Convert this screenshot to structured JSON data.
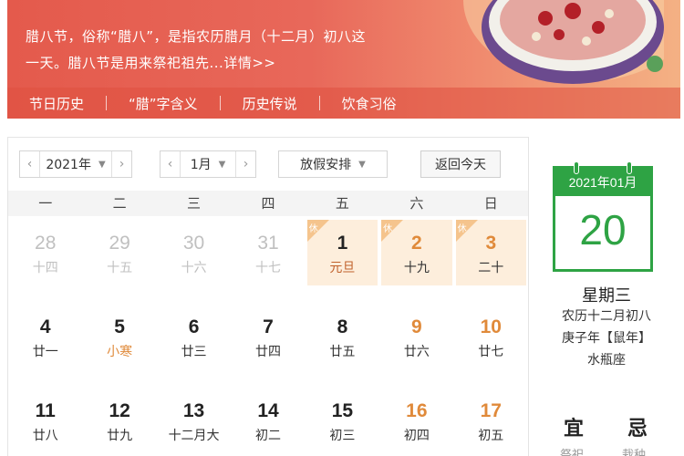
{
  "banner": {
    "text_line1": "腊八节，俗称“腊八”，是指农历腊月（十二月）初八这",
    "text_line2": "一天。腊八节是用来祭祀祖先...",
    "more_label": "详情>>",
    "nav": [
      "节日历史",
      "“腊”字含义",
      "历史传说",
      "饮食习俗"
    ]
  },
  "toolbar": {
    "year": "2021年",
    "month": "1月",
    "holiday": "放假安排",
    "today": "返回今天",
    "prev_icon": "chevron-left-icon",
    "next_icon": "chevron-right-icon",
    "caret_icon": "caret-down-icon"
  },
  "weekdays": [
    "一",
    "二",
    "三",
    "四",
    "五",
    "六",
    "日"
  ],
  "days": [
    {
      "d": "28",
      "l": "十四",
      "other": true
    },
    {
      "d": "29",
      "l": "十五",
      "other": true
    },
    {
      "d": "30",
      "l": "十六",
      "other": true
    },
    {
      "d": "31",
      "l": "十七",
      "other": true
    },
    {
      "d": "1",
      "l": "元旦",
      "hol": true,
      "badge": "休",
      "festival": true
    },
    {
      "d": "2",
      "l": "十九",
      "hol": true,
      "badge": "休",
      "weekend": true
    },
    {
      "d": "3",
      "l": "二十",
      "hol": true,
      "badge": "休",
      "weekend": true
    },
    {
      "d": "4",
      "l": "廿一"
    },
    {
      "d": "5",
      "l": "小寒",
      "term": true
    },
    {
      "d": "6",
      "l": "廿三"
    },
    {
      "d": "7",
      "l": "廿四"
    },
    {
      "d": "8",
      "l": "廿五"
    },
    {
      "d": "9",
      "l": "廿六",
      "weekend": true
    },
    {
      "d": "10",
      "l": "廿七",
      "weekend": true
    },
    {
      "d": "11",
      "l": "廿八"
    },
    {
      "d": "12",
      "l": "廿九"
    },
    {
      "d": "13",
      "l": "十二月大"
    },
    {
      "d": "14",
      "l": "初二"
    },
    {
      "d": "15",
      "l": "初三"
    },
    {
      "d": "16",
      "l": "初四",
      "weekend": true
    },
    {
      "d": "17",
      "l": "初五",
      "weekend": true
    }
  ],
  "side": {
    "card_header": "2021年01月",
    "card_day": "20",
    "weekday": "星期三",
    "lunar": "农历十二月初八",
    "ganzhi": "庚子年【鼠年】",
    "zodiac": "水瓶座",
    "yi": "宜",
    "ji": "忌",
    "yi_small": "祭祀",
    "ji_small": "栽种"
  },
  "colors": {
    "banner": "#e45a4c",
    "accent_green": "#2ea344",
    "weekend_orange": "#e08a3a",
    "holiday_bg": "#fdeedc"
  }
}
